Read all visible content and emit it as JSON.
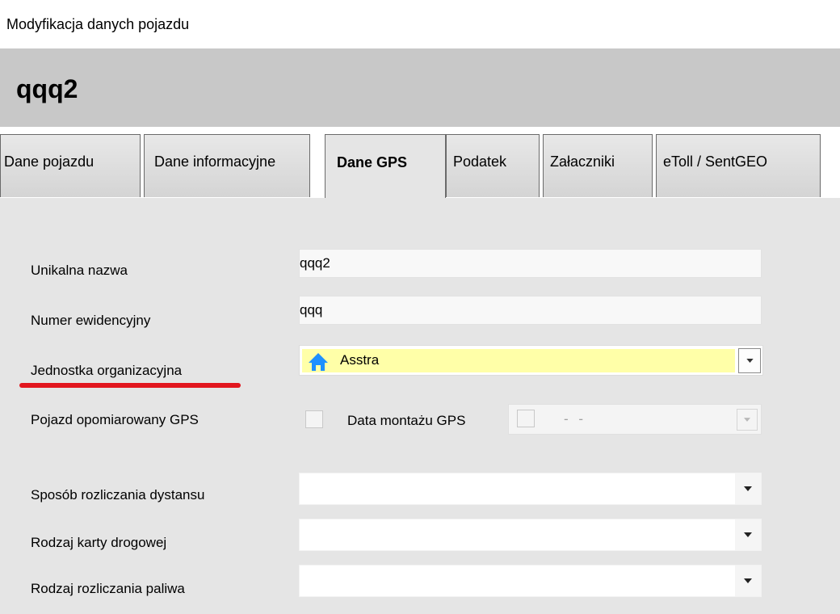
{
  "window": {
    "title": "Modyfikacja danych pojazdu"
  },
  "header": {
    "title": "qqq2"
  },
  "tabs": [
    {
      "label": "Dane pojazdu",
      "active": false
    },
    {
      "label": "Dane informacyjne",
      "active": false
    },
    {
      "label": "Dane GPS",
      "active": true
    },
    {
      "label": "Podatek",
      "active": false
    },
    {
      "label": "Załaczniki",
      "active": false
    },
    {
      "label": "eToll / SentGEO",
      "active": false
    }
  ],
  "form": {
    "unique_name": {
      "label": "Unikalna nazwa",
      "value": "qqq2"
    },
    "reg_number": {
      "label": "Numer ewidencyjny",
      "value": "qqq"
    },
    "org_unit": {
      "label": "Jednostka organizacyjna",
      "value": "Asstra",
      "icon": "home-icon",
      "highlight_color": "#ffffa8"
    },
    "gps_measured": {
      "label": "Pojazd opomiarowany GPS",
      "checked": false
    },
    "gps_install_date": {
      "label": "Data montażu GPS",
      "checked": false,
      "value": "- -"
    },
    "distance_method": {
      "label": "Sposób rozliczania dystansu",
      "value": ""
    },
    "road_card_type": {
      "label": "Rodzaj karty drogowej",
      "value": ""
    },
    "fuel_settlement": {
      "label": "Rodzaj rozliczania paliwa",
      "value": ""
    }
  },
  "colors": {
    "header_bg": "#c8c8c8",
    "panel_bg": "#e5e5e5",
    "underline": "#e2161e",
    "home_icon": "#1e90ff"
  }
}
